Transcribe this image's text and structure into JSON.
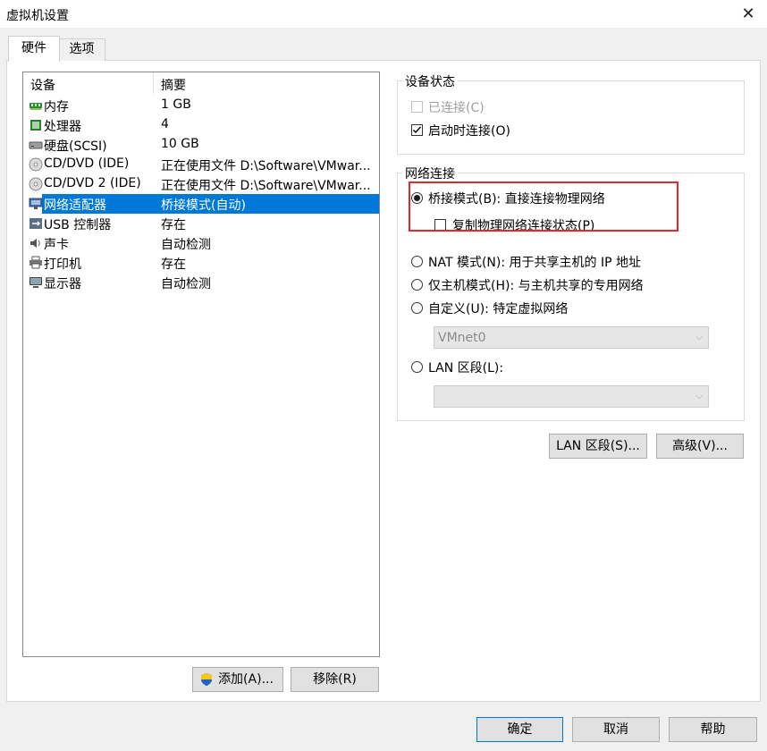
{
  "window": {
    "title": "虚拟机设置",
    "close_glyph": "✕"
  },
  "tabs": [
    {
      "label": "硬件"
    },
    {
      "label": "选项"
    }
  ],
  "device_list": {
    "headers": {
      "device": "设备",
      "summary": "摘要"
    },
    "rows": [
      {
        "name": "内存",
        "summary": "1 GB",
        "icon": "memory-icon"
      },
      {
        "name": "处理器",
        "summary": "4",
        "icon": "processor-icon"
      },
      {
        "name": "硬盘(SCSI)",
        "summary": "10 GB",
        "icon": "harddisk-icon"
      },
      {
        "name": "CD/DVD (IDE)",
        "summary": "正在使用文件 D:\\Software\\VMwar...",
        "icon": "cd-dvd-icon"
      },
      {
        "name": "CD/DVD 2 (IDE)",
        "summary": "正在使用文件 D:\\Software\\VMwar...",
        "icon": "cd-dvd-icon"
      },
      {
        "name": "网络适配器",
        "summary": "桥接模式(自动)",
        "icon": "network-adapter-icon",
        "selected": true
      },
      {
        "name": "USB 控制器",
        "summary": "存在",
        "icon": "usb-icon"
      },
      {
        "name": "声卡",
        "summary": "自动检测",
        "icon": "sound-card-icon"
      },
      {
        "name": "打印机",
        "summary": "存在",
        "icon": "printer-icon"
      },
      {
        "name": "显示器",
        "summary": "自动检测",
        "icon": "display-icon"
      }
    ]
  },
  "list_buttons": {
    "add": "添加(A)...",
    "remove": "移除(R)"
  },
  "device_status": {
    "title": "设备状态",
    "connected": "已连接(C)",
    "connect_at_power_on": "启动时连接(O)"
  },
  "network": {
    "title": "网络连接",
    "bridged": "桥接模式(B): 直接连接物理网络",
    "replicate": "复制物理网络连接状态(P)",
    "nat": "NAT 模式(N): 用于共享主机的 IP 地址",
    "host_only": "仅主机模式(H): 与主机共享的专用网络",
    "custom": "自定义(U): 特定虚拟网络",
    "custom_value": "VMnet0",
    "lan_segment": "LAN 区段(L):",
    "lan_segment_value": ""
  },
  "side_buttons": {
    "lan_segments": "LAN 区段(S)...",
    "advanced": "高级(V)..."
  },
  "dialog_buttons": {
    "ok": "确定",
    "cancel": "取消",
    "help": "帮助"
  },
  "colors": {
    "selection": "#0078d7",
    "highlight_box": "#e0282e"
  }
}
